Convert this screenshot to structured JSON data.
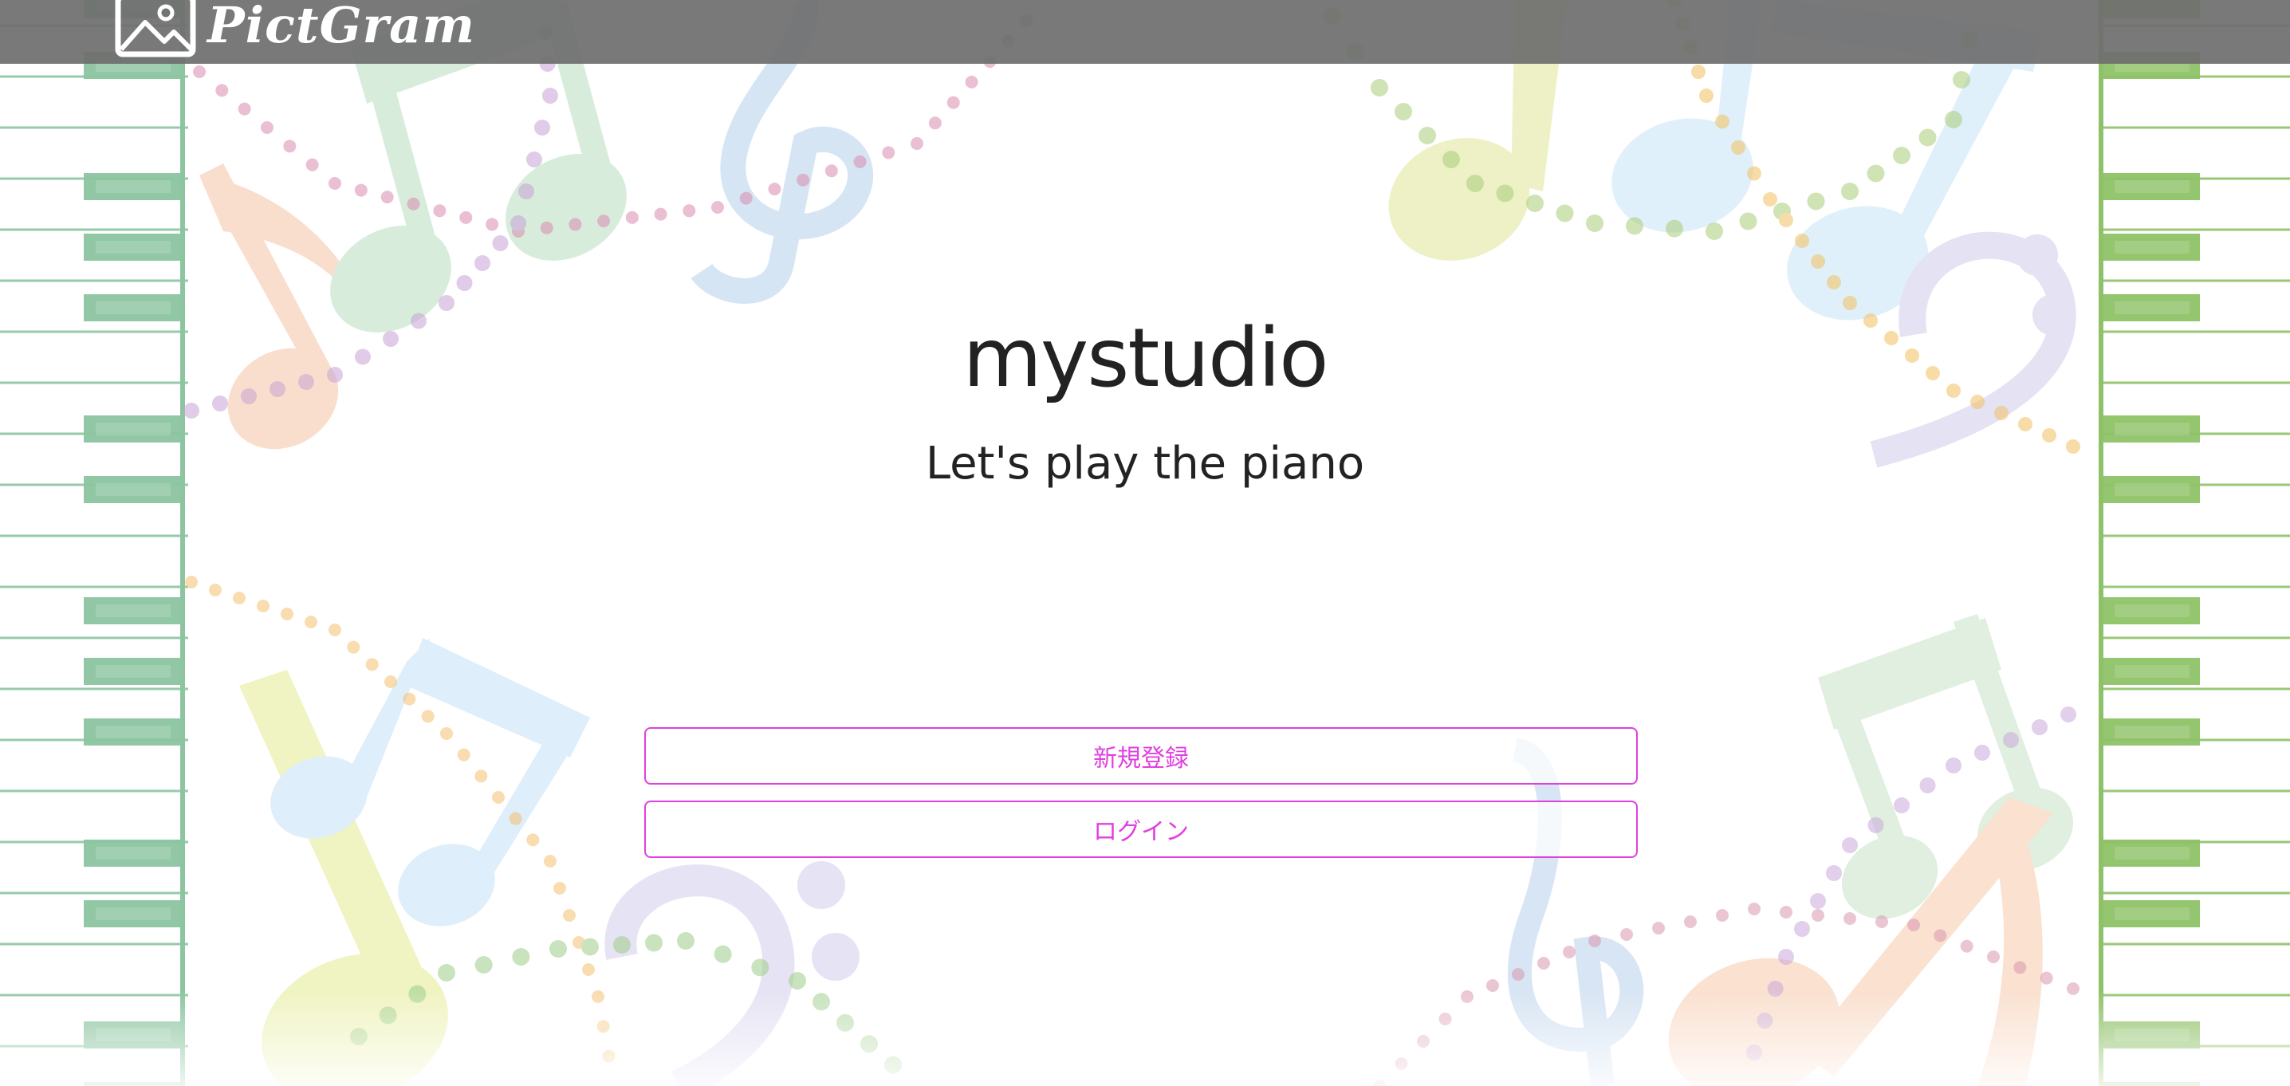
{
  "navbar": {
    "brand": "PictGram",
    "brand_icon": "image-icon"
  },
  "hero": {
    "title": "mystudio",
    "subtitle": "Let's play the piano"
  },
  "buttons": {
    "signup": "新規登録",
    "login": "ログイン"
  },
  "colors": {
    "accent": "#e040e0",
    "navbar": "#6e6e6e",
    "piano_left": "#8cc5a0",
    "piano_right": "#8fc268"
  },
  "decorations": {
    "background_icons": [
      "eighth-note-icon",
      "beamed-notes-icon",
      "treble-clef-icon",
      "bass-clef-icon",
      "piano-keys"
    ]
  }
}
